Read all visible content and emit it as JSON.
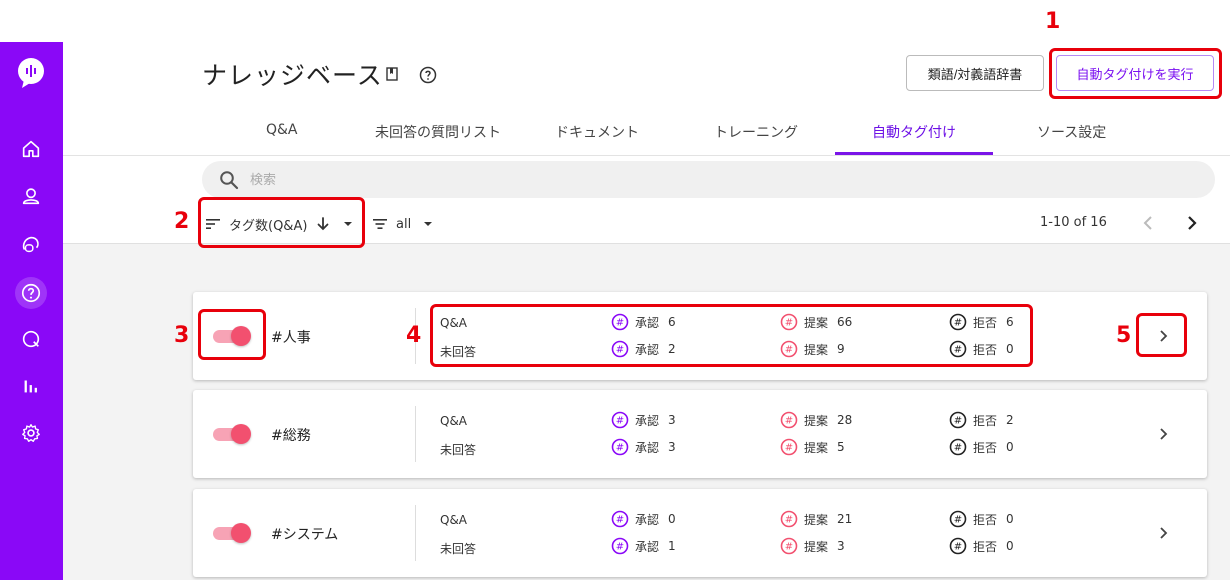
{
  "header": {
    "title": "ナレッジベース",
    "synonym_button": "類語/対義語辞書",
    "autotag_button": "自動タグ付けを実行"
  },
  "tabs": [
    {
      "label": "Q&A"
    },
    {
      "label": "未回答の質問リスト"
    },
    {
      "label": "ドキュメント"
    },
    {
      "label": "トレーニング"
    },
    {
      "label": "自動タグ付け"
    },
    {
      "label": "ソース設定"
    }
  ],
  "search": {
    "placeholder": "検索"
  },
  "sort": {
    "label": "タグ数(Q&A)"
  },
  "filter": {
    "label": "all"
  },
  "pagination": {
    "text": "1-10 of 16"
  },
  "stat_labels": {
    "qa": "Q&A",
    "unanswered": "未回答",
    "approve": "承認",
    "suggest": "提案",
    "reject": "拒否"
  },
  "cards": [
    {
      "tag": "#人事",
      "qa": {
        "approve": "6",
        "suggest": "66",
        "reject": "6"
      },
      "unanswered": {
        "approve": "2",
        "suggest": "9",
        "reject": "0"
      }
    },
    {
      "tag": "#総務",
      "qa": {
        "approve": "3",
        "suggest": "28",
        "reject": "2"
      },
      "unanswered": {
        "approve": "3",
        "suggest": "5",
        "reject": "0"
      }
    },
    {
      "tag": "#システム",
      "qa": {
        "approve": "0",
        "suggest": "21",
        "reject": "0"
      },
      "unanswered": {
        "approve": "1",
        "suggest": "3",
        "reject": "0"
      }
    }
  ],
  "annotations": [
    "1",
    "2",
    "3",
    "4",
    "5"
  ],
  "colors": {
    "sidebar": "#8a08f7",
    "accent": "#7a0ff0",
    "toggle_on": "#f2506f",
    "approve": "#8a08f7",
    "suggest": "#f2506f",
    "reject": "#222222",
    "annotation": "#e8000b"
  },
  "icons": {
    "sidebar": [
      "logo-icon",
      "home-icon",
      "user-icon",
      "chat-icon",
      "question-icon",
      "search-chat-icon",
      "analytics-icon",
      "settings-icon"
    ],
    "stat": "hashtag-icon"
  }
}
